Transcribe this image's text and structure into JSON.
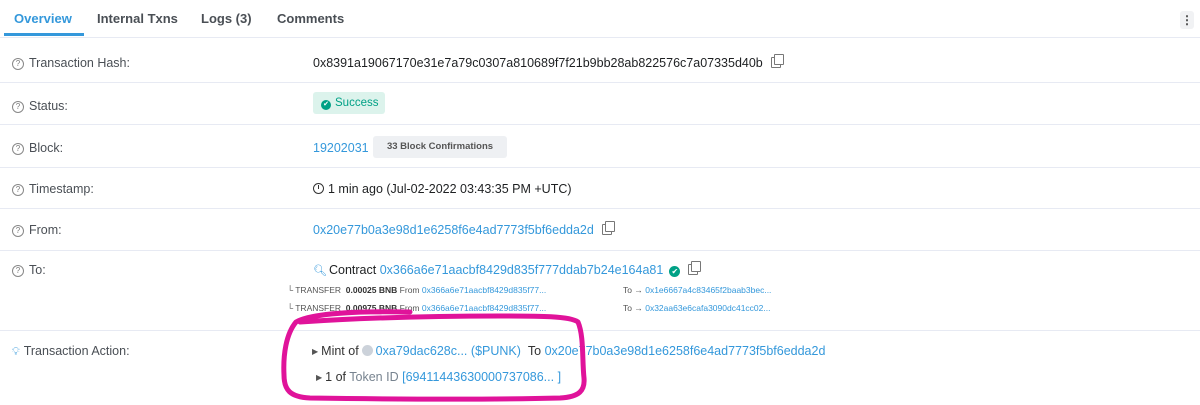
{
  "tabs": [
    {
      "label": "Overview"
    },
    {
      "label": "Internal Txns"
    },
    {
      "label": "Logs (3)"
    },
    {
      "label": "Comments"
    }
  ],
  "menu_icon": "⋮",
  "rows": {
    "hash": {
      "label": "Transaction Hash:",
      "value": "0x8391a19067170e31e7a79c0307a810689f7f21b9bb28ab822576c7a07335d40b"
    },
    "status": {
      "label": "Status:",
      "value": "Success"
    },
    "block": {
      "label": "Block:",
      "value": "19202031",
      "confirmations": "33 Block Confirmations"
    },
    "timestamp": {
      "label": "Timestamp:",
      "value": "1 min ago (Jul-02-2022 03:43:35 PM +UTC)"
    },
    "from": {
      "label": "From:",
      "value": "0x20e77b0a3e98d1e6258f6e4ad7773f5bf6edda2d"
    },
    "to": {
      "label": "To:",
      "prefix": "Contract",
      "value": "0x366a6e71aacbf8429d835f777ddab7b24e164a81",
      "transfers": [
        {
          "kind": "TRANSFER",
          "amount": "0.00025 BNB",
          "from_label": "From",
          "from": "0x366a6e71aacbf8429d835f77...",
          "to_label": "To",
          "to": "0x1e6667a4c83465f2baab3bec..."
        },
        {
          "kind": "TRANSFER",
          "amount": "0.00975 BNB",
          "from_label": "From",
          "from": "0x366a6e71aacbf8429d835f77...",
          "to_label": "To",
          "to": "0x32aa63e6cafa3090dc41cc02..."
        }
      ]
    },
    "action": {
      "label": "Transaction Action:",
      "mint_prefix": "Mint of",
      "token": "0xa79dac628c...",
      "symbol": "($PUNK)",
      "to_label": "To",
      "to": "0x20e77b0a3e98d1e6258f6e4ad7773f5bf6edda2d",
      "qty": "1 of",
      "token_id_label": "Token ID",
      "token_id": "[69411443630000737086... ]"
    }
  },
  "colors": {
    "accent": "#3498db",
    "success": "#00a186",
    "success_bg": "#dcf3ec",
    "annotation": "#e0139a"
  },
  "icons": [
    "question-circle-icon",
    "check-circle-icon",
    "copy-icon",
    "clock-icon",
    "contract-search-icon",
    "verified-icon",
    "lightbulb-icon",
    "triangle-right-icon",
    "token-icon",
    "kebab-menu-icon"
  ]
}
